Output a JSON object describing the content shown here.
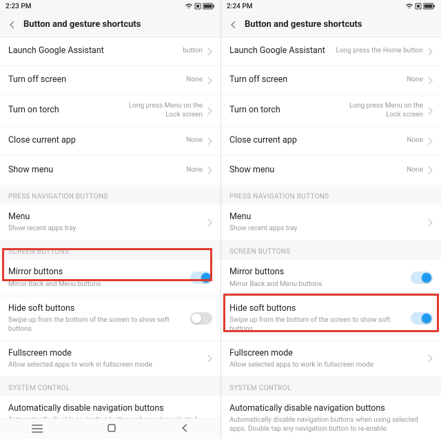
{
  "left": {
    "time": "2:23 PM",
    "title": "Button and gesture shortcuts",
    "rows": {
      "launch_assistant": {
        "label": "Launch Google Assistant",
        "value": "button"
      },
      "turn_off_screen": {
        "label": "Turn off screen",
        "value": "None"
      },
      "turn_on_torch": {
        "label": "Turn on torch",
        "value": "Long press Menu on the Lock screen"
      },
      "close_app": {
        "label": "Close current app",
        "value": "None"
      },
      "show_menu": {
        "label": "Show menu",
        "value": "None"
      }
    },
    "section_press": "PRESS NAVIGATION BUTTONS",
    "menu_row": {
      "label": "Menu",
      "sub": "Show recent apps tray"
    },
    "section_screen": "SCREEN BUTTONS",
    "mirror": {
      "label": "Mirror buttons",
      "sub": "Mirror Back and Menu buttons",
      "on": true
    },
    "hide_soft": {
      "label": "Hide soft buttons",
      "sub": "Swipe up from the bottom of the screen to show soft buttons",
      "on": false
    },
    "fullscreen": {
      "label": "Fullscreen mode",
      "sub": "Allow selected apps to work in fullscreen mode"
    },
    "section_system": "SYSTEM CONTROL",
    "auto_disable": {
      "label": "Automatically disable navigation buttons",
      "sub": "Automatically disable navigation buttons when using selected"
    }
  },
  "right": {
    "time": "2:24 PM",
    "title": "Button and gesture shortcuts",
    "rows": {
      "launch_assistant": {
        "label": "Launch Google Assistant",
        "value": "Long press the Home button"
      },
      "turn_off_screen": {
        "label": "Turn off screen",
        "value": "None"
      },
      "turn_on_torch": {
        "label": "Turn on torch",
        "value": "Long press Menu on the Lock screen"
      },
      "close_app": {
        "label": "Close current app",
        "value": "None"
      },
      "show_menu": {
        "label": "Show menu",
        "value": "None"
      }
    },
    "section_press": "PRESS NAVIGATION BUTTONS",
    "menu_row": {
      "label": "Menu",
      "sub": "Show recent apps tray"
    },
    "section_screen": "SCREEN BUTTONS",
    "mirror": {
      "label": "Mirror buttons",
      "sub": "Mirror Back and Menu buttons",
      "on": true
    },
    "hide_soft": {
      "label": "Hide soft buttons",
      "sub": "Swipe up from the bottom of the screen to show soft buttons",
      "on": true
    },
    "fullscreen": {
      "label": "Fullscreen mode",
      "sub": "Allow selected apps to work in fullscreen mode"
    },
    "section_system": "SYSTEM CONTROL",
    "auto_disable": {
      "label": "Automatically disable navigation buttons",
      "sub": "Automatically disable navigation buttons when using selected apps. Double tap any navigation button to re-enable."
    }
  }
}
